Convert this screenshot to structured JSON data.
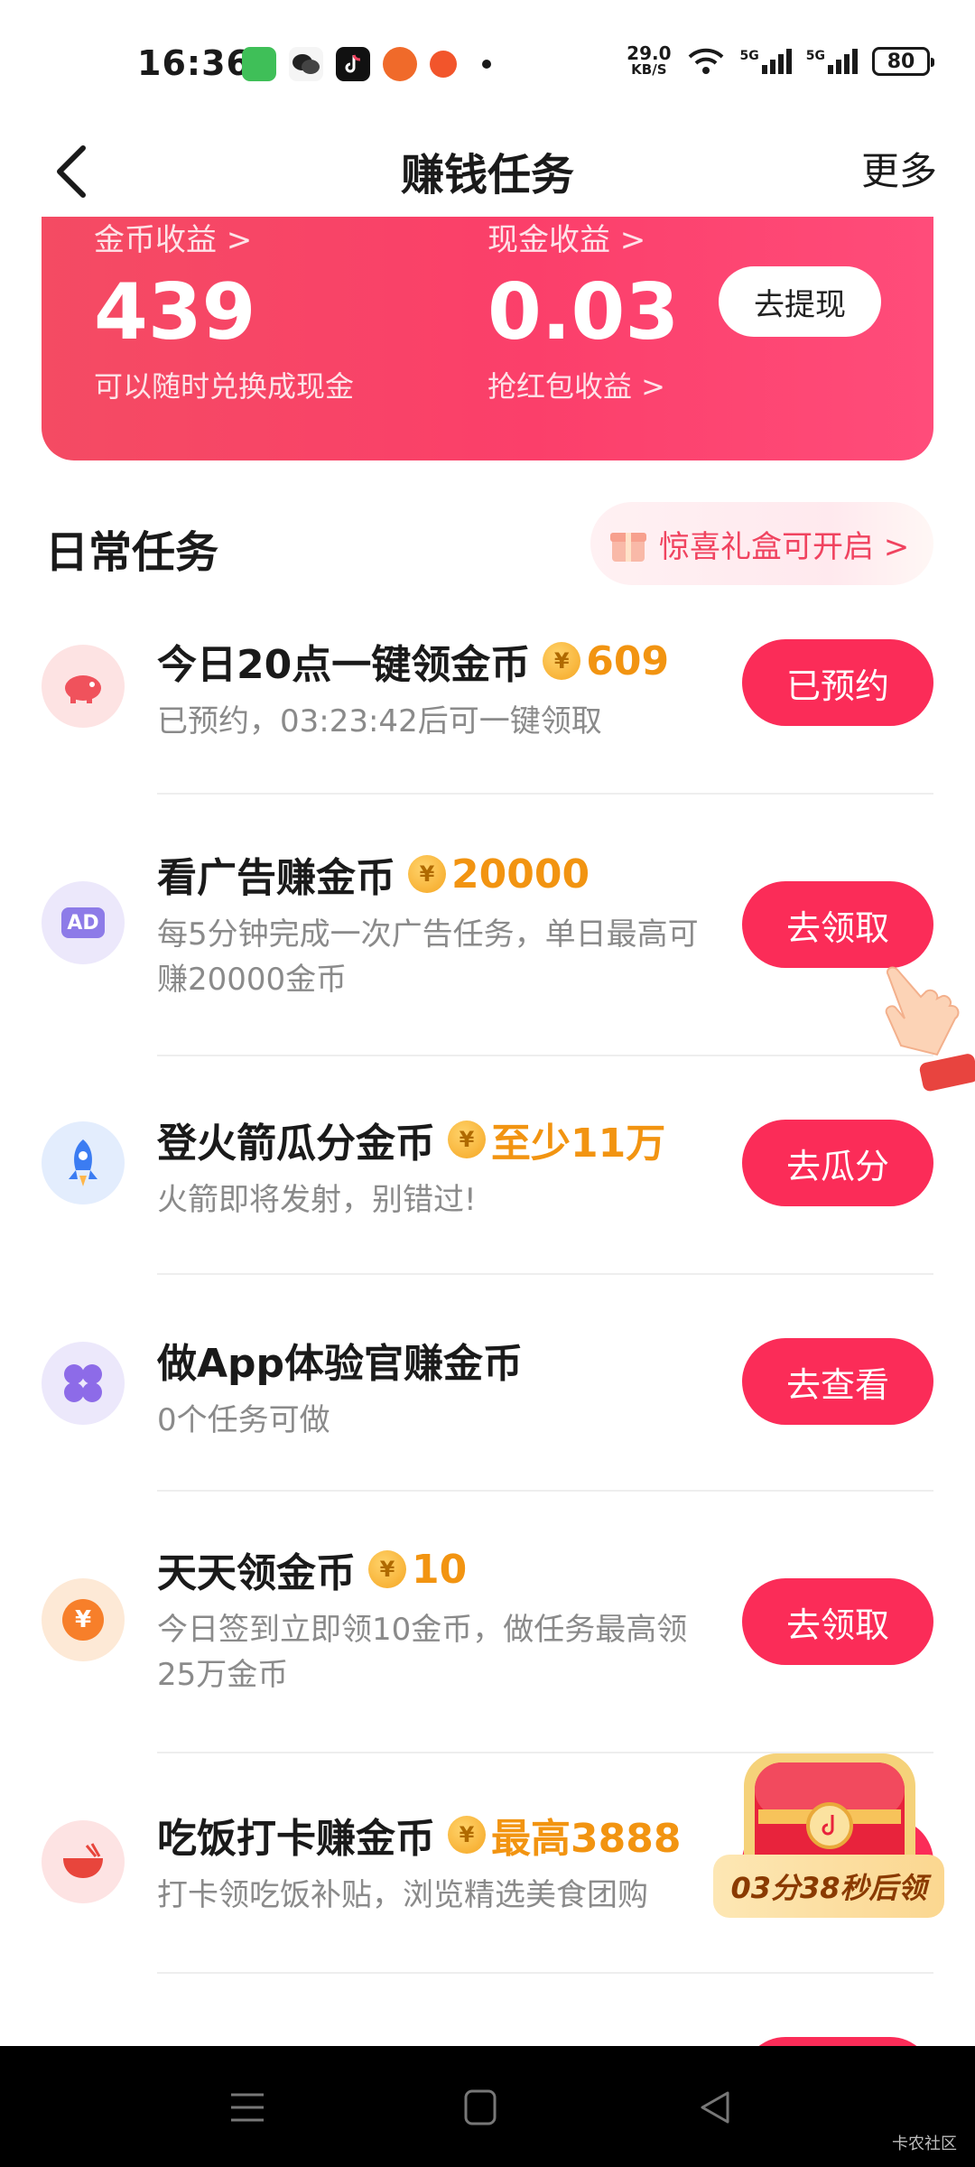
{
  "status_bar": {
    "time": "16:36",
    "net_speed": "29.0",
    "net_unit": "KB/S",
    "battery": "80",
    "signal_labels": [
      "5G",
      "5G"
    ]
  },
  "nav": {
    "title": "赚钱任务",
    "more": "更多"
  },
  "earnings": {
    "coin_label": "金币收益 >",
    "coin_value": "439",
    "coin_sub": "可以随时兑换成现金",
    "cash_label": "现金收益 >",
    "cash_value": "0.03",
    "cash_sub": "抢红包收益 >",
    "withdraw": "去提现"
  },
  "daily": {
    "title": "日常任务",
    "gift_text": "惊喜礼盒可开启 >"
  },
  "tasks": [
    {
      "title": "今日20点一键领金币",
      "reward": "609",
      "desc": "已预约，03:23:42后可一键领取",
      "button": "已预约",
      "icon": "piggy-bank-icon"
    },
    {
      "title": "看广告赚金币",
      "reward": "20000",
      "desc": "每5分钟完成一次广告任务，单日最高可赚20000金币",
      "button": "去领取",
      "icon": "ad-icon"
    },
    {
      "title": "登火箭瓜分金币",
      "reward": "至少11万",
      "desc": "火箭即将发射，别错过!",
      "button": "去瓜分",
      "icon": "rocket-icon"
    },
    {
      "title": "做App体验官赚金币",
      "reward": "",
      "desc": "0个任务可做",
      "button": "去查看",
      "icon": "apps-grid-icon"
    },
    {
      "title": "天天领金币",
      "reward": "10",
      "desc": "今日签到立即领10金币，做任务最高领25万金币",
      "button": "去领取",
      "icon": "yuan-coin-icon"
    },
    {
      "title": "吃饭打卡赚金币",
      "reward": "最高3888",
      "desc": "打卡领吃饭补贴，浏览精选美食团购",
      "button": "",
      "icon": "rice-bowl-icon"
    }
  ],
  "chest": {
    "timer": "03分38秒后领"
  },
  "watermark": "卡农社区",
  "colors": {
    "accent": "#fb2c58",
    "reward": "#f29411",
    "card": "#f44b63"
  }
}
